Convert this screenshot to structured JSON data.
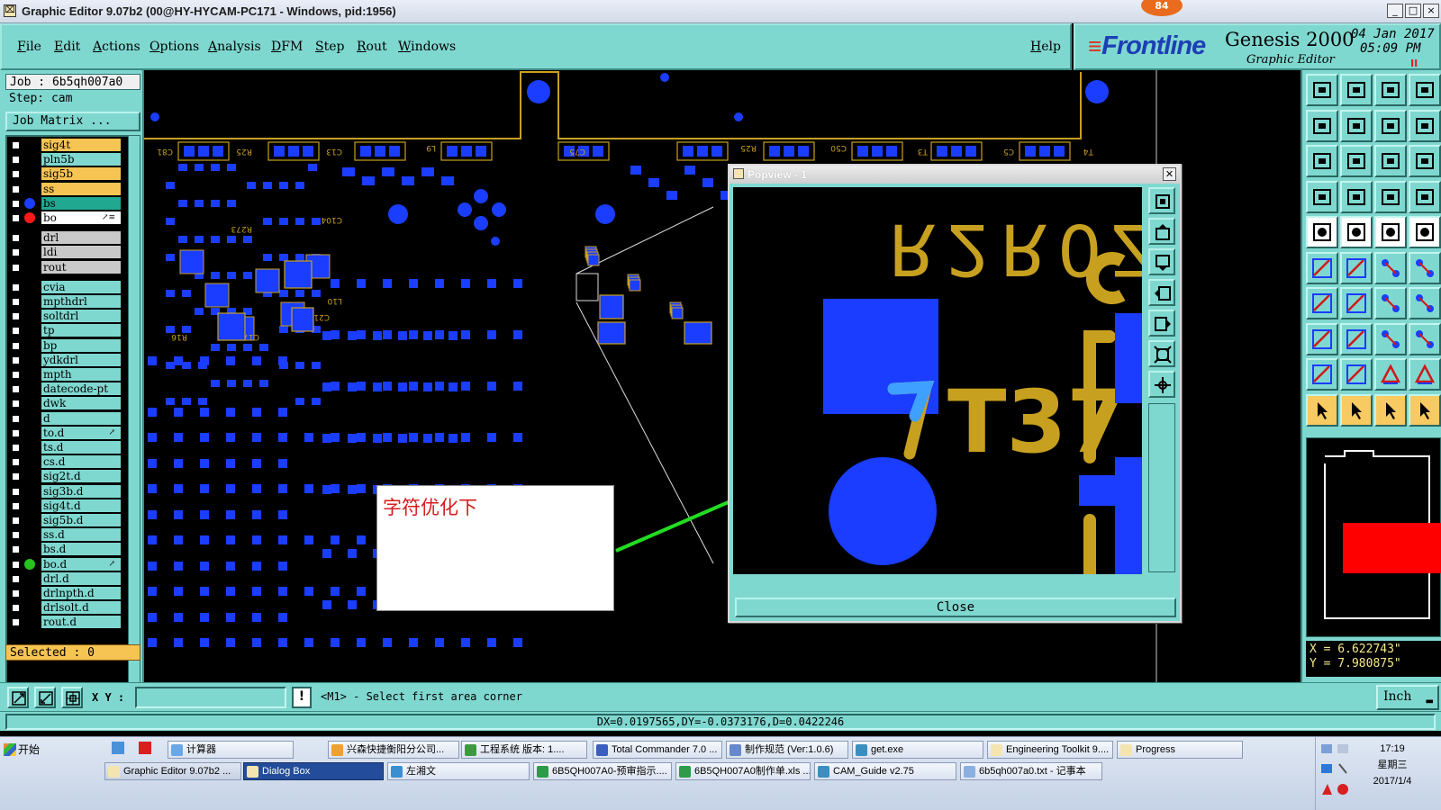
{
  "window": {
    "title": "Graphic Editor 9.07b2 (00@HY-HYCAM-PC171 - Windows, pid:1956)",
    "badge": "84",
    "controls": [
      "_",
      "□",
      "×"
    ]
  },
  "menu": [
    "File",
    "Edit",
    "Actions",
    "Options",
    "Analysis",
    "DFM",
    "Step",
    "Rout",
    "Windows"
  ],
  "help": "Help",
  "logo": {
    "brand": "Frontline",
    "product": "Genesis 2000",
    "subtitle": "Graphic Editor",
    "date": "04 Jan 2017",
    "time": "05:09 PM",
    "pause": "II"
  },
  "job": {
    "job_line": "Job : 6b5qh007a0",
    "step_line": "Step: cam",
    "matrix_button": "Job Matrix ..."
  },
  "layers": [
    {
      "name": "sig4t",
      "color": "#f6c453"
    },
    {
      "name": "pln5b",
      "color": "#7fd8d0"
    },
    {
      "name": "sig5b",
      "color": "#f6c453"
    },
    {
      "name": "ss",
      "color": "#f6c453"
    },
    {
      "name": "bs",
      "color": "#21a891",
      "dot": "#1a3dff"
    },
    {
      "name": "bo",
      "color": "#ffffff",
      "dot": "#ff1a1a",
      "mark": "↗≡"
    },
    {
      "name": "drl",
      "color": "#c9c9c9"
    },
    {
      "name": "ldi",
      "color": "#c9c9c9"
    },
    {
      "name": "rout",
      "color": "#c9c9c9"
    },
    {
      "name": "cvia",
      "color": "#7fd8d0"
    },
    {
      "name": "mpthdrl",
      "color": "#7fd8d0"
    },
    {
      "name": "soltdrl",
      "color": "#7fd8d0"
    },
    {
      "name": "tp",
      "color": "#7fd8d0"
    },
    {
      "name": "bp",
      "color": "#7fd8d0"
    },
    {
      "name": "ydkdrl",
      "color": "#7fd8d0"
    },
    {
      "name": "mpth",
      "color": "#7fd8d0"
    },
    {
      "name": "datecode-pt",
      "color": "#7fd8d0"
    },
    {
      "name": "dwk",
      "color": "#7fd8d0"
    },
    {
      "name": "d",
      "color": "#7fd8d0"
    },
    {
      "name": "to.d",
      "color": "#7fd8d0",
      "mark": "↗"
    },
    {
      "name": "ts.d",
      "color": "#7fd8d0"
    },
    {
      "name": "cs.d",
      "color": "#7fd8d0"
    },
    {
      "name": "sig2t.d",
      "color": "#7fd8d0"
    },
    {
      "name": "sig3b.d",
      "color": "#7fd8d0"
    },
    {
      "name": "sig4t.d",
      "color": "#7fd8d0"
    },
    {
      "name": "sig5b.d",
      "color": "#7fd8d0"
    },
    {
      "name": "ss.d",
      "color": "#7fd8d0"
    },
    {
      "name": "bs.d",
      "color": "#7fd8d0"
    },
    {
      "name": "bo.d",
      "color": "#7fd8d0",
      "dot": "#27c21e",
      "mark": "↗"
    },
    {
      "name": "drl.d",
      "color": "#7fd8d0"
    },
    {
      "name": "drlnpth.d",
      "color": "#7fd8d0"
    },
    {
      "name": "drlsolt.d",
      "color": "#7fd8d0"
    },
    {
      "name": "rout.d",
      "color": "#7fd8d0"
    }
  ],
  "selected": "Selected : 0",
  "popview": {
    "title": "Popview - 1",
    "close_button": "Close",
    "zoom_text_top": "R2R0Z",
    "zoom_text_main": "T37"
  },
  "annotation": {
    "text": "字符优化下"
  },
  "coords": {
    "x": "X = 6.622743\"",
    "y": "Y = 7.980875\""
  },
  "command": {
    "xy_label": "X Y :",
    "xy_value": "",
    "info": "!",
    "message": "<M1> - Select first area corner",
    "unit": "Inch"
  },
  "status": "DX=0.0197565,DY=-0.0373176,D=0.0422246",
  "taskbar": {
    "start": "开始",
    "row1": [
      {
        "label": "计算器",
        "color": "#6aa7e8"
      },
      {
        "label": "兴森快捷衡阳分公司...",
        "color": "#f0a030"
      },
      {
        "label": "工程系统  版本: 1....",
        "color": "#3c9a3c"
      },
      {
        "label": "Total Commander 7.0 ...",
        "color": "#3a5fc0"
      },
      {
        "label": "制作规范 (Ver:1.0.6)",
        "color": "#6688cc"
      },
      {
        "label": "get.exe",
        "color": "#3a8fc0"
      },
      {
        "label": "Engineering Toolkit 9....",
        "color": "#f4e4b0"
      },
      {
        "label": "Progress",
        "color": "#f4e4b0"
      }
    ],
    "row2": [
      {
        "label": "Graphic Editor 9.07b2 ...",
        "color": "#f4e4b0",
        "state": "dark"
      },
      {
        "label": "Dialog Box",
        "color": "#f4e4b0",
        "state": "active"
      },
      {
        "label": "左湘文",
        "color": "#3a8fd0"
      },
      {
        "label": "6B5QH007A0-预审指示....",
        "color": "#2f9a4a"
      },
      {
        "label": "6B5QH007A0制作单.xls ...",
        "color": "#2f9a4a"
      },
      {
        "label": "CAM_Guide v2.75",
        "color": "#3a8fc0"
      },
      {
        "label": "6b5qh007a0.txt - 记事本",
        "color": "#8ab0e0"
      }
    ],
    "clock": {
      "time": "17:19",
      "day": "星期三",
      "date": "2017/1/4"
    }
  },
  "colors": {
    "panel": "#7fd8d0",
    "pad_blue": "#1a3dff",
    "silk": "#c8a020",
    "arrow": "#22dd22",
    "nav_red": "#ff0000"
  }
}
